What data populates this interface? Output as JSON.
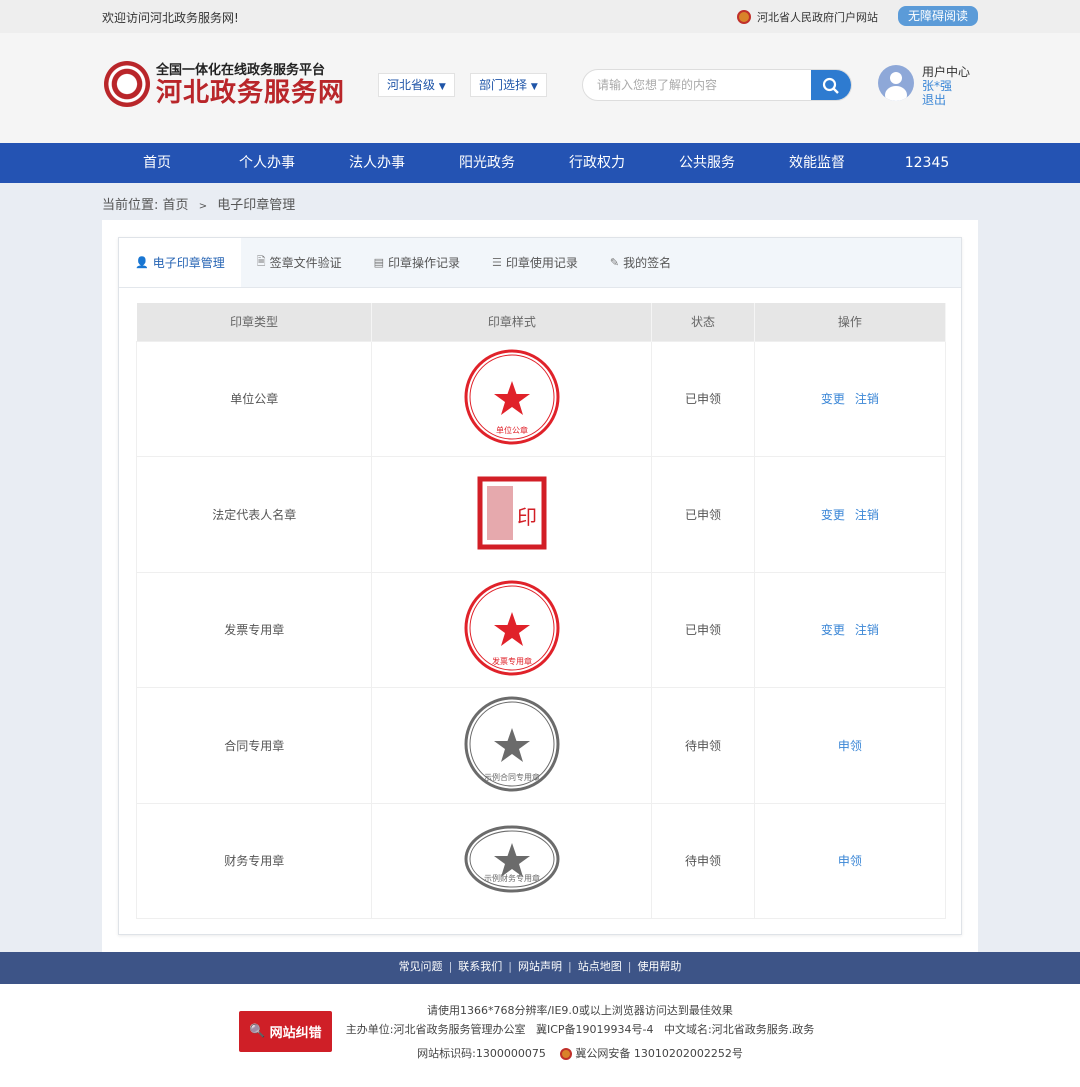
{
  "topbar": {
    "welcome": "欢迎访问河北政务服务网!",
    "gov_link": "河北省人民政府门户网站",
    "accessibility": "无障碍阅读"
  },
  "header": {
    "logo_sub": "全国一体化在线政务服务平台",
    "logo_main": "河北政务服务网",
    "region": "河北省级",
    "dept": "部门选择",
    "search_placeholder": "请输入您想了解的内容",
    "user_center": "用户中心",
    "user_name": "张*强",
    "logout": "退出"
  },
  "nav": [
    "首页",
    "个人办事",
    "法人办事",
    "阳光政务",
    "行政权力",
    "公共服务",
    "效能监督",
    "12345"
  ],
  "breadcrumb": {
    "label": "当前位置:",
    "home": "首页",
    "sep": ">",
    "current": "电子印章管理"
  },
  "tabs": [
    "电子印章管理",
    "签章文件验证",
    "印章操作记录",
    "印章使用记录",
    "我的签名"
  ],
  "table": {
    "headers": [
      "印章类型",
      "印章样式",
      "状态",
      "操作"
    ],
    "rows": [
      {
        "type": "单位公章",
        "seal_text": "单位公章",
        "status": "已申领",
        "actions": [
          "变更",
          "注销"
        ],
        "color": "#e0222a",
        "shape": "circle"
      },
      {
        "type": "法定代表人名章",
        "seal_text": "",
        "status": "已申领",
        "actions": [
          "变更",
          "注销"
        ],
        "color": "#d21e26",
        "shape": "square"
      },
      {
        "type": "发票专用章",
        "seal_text": "发票专用章",
        "status": "已申领",
        "actions": [
          "变更",
          "注销"
        ],
        "color": "#e0222a",
        "shape": "circle"
      },
      {
        "type": "合同专用章",
        "seal_text": "示例合同专用章",
        "status": "待申领",
        "actions": [
          "申领"
        ],
        "color": "#6b6b6b",
        "shape": "circle"
      },
      {
        "type": "财务专用章",
        "seal_text": "示例财务专用章",
        "status": "待申领",
        "actions": [
          "申领"
        ],
        "color": "#6b6b6b",
        "shape": "ellipse"
      }
    ]
  },
  "footer": {
    "links": [
      "常见问题",
      "联系我们",
      "网站声明",
      "站点地图",
      "使用帮助"
    ],
    "report": "网站纠错",
    "line1": "请使用1366*768分辨率/IE9.0或以上浏览器访问达到最佳效果",
    "line2": "主办单位:河北省政务服务管理办公室   冀ICP备19019934号-4   中文域名:河北省政务服务.政务",
    "site_id": "网站标识码:1300000075",
    "police": "冀公网安备 13010202002252号"
  }
}
